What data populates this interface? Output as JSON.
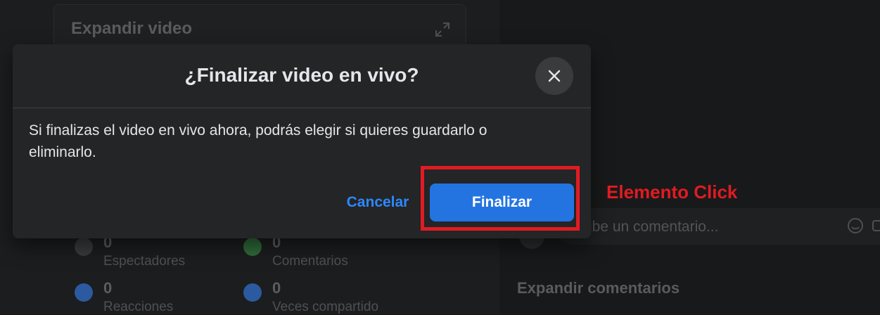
{
  "background": {
    "expand_video": "Expandir video",
    "stats": [
      {
        "value": "0",
        "label": "Espectadores",
        "icon": "eye-icon",
        "color": "#3a3b3c"
      },
      {
        "value": "0",
        "label": "Comentarios",
        "icon": "comment-icon",
        "color": "#2e6b3a"
      },
      {
        "value": "0",
        "label": "Reacciones",
        "icon": "like-icon",
        "color": "#2c5aa0"
      },
      {
        "value": "0",
        "label": "Veces compartido",
        "icon": "share-icon",
        "color": "#2c5aa0"
      }
    ],
    "comment_placeholder": "ribe un comentario...",
    "expand_comments": "Expandir comentarios"
  },
  "dialog": {
    "title": "¿Finalizar video en vivo?",
    "body": "Si finalizas el video en vivo ahora, podrás elegir si quieres guardarlo o eliminarlo.",
    "cancel_label": "Cancelar",
    "confirm_label": "Finalizar"
  },
  "annotation": {
    "label": "Elemento Click",
    "color": "#e11b22"
  },
  "colors": {
    "primary": "#2374e1",
    "link": "#2d88ff",
    "dialog_bg": "#242526",
    "page_bg": "#18191a"
  }
}
